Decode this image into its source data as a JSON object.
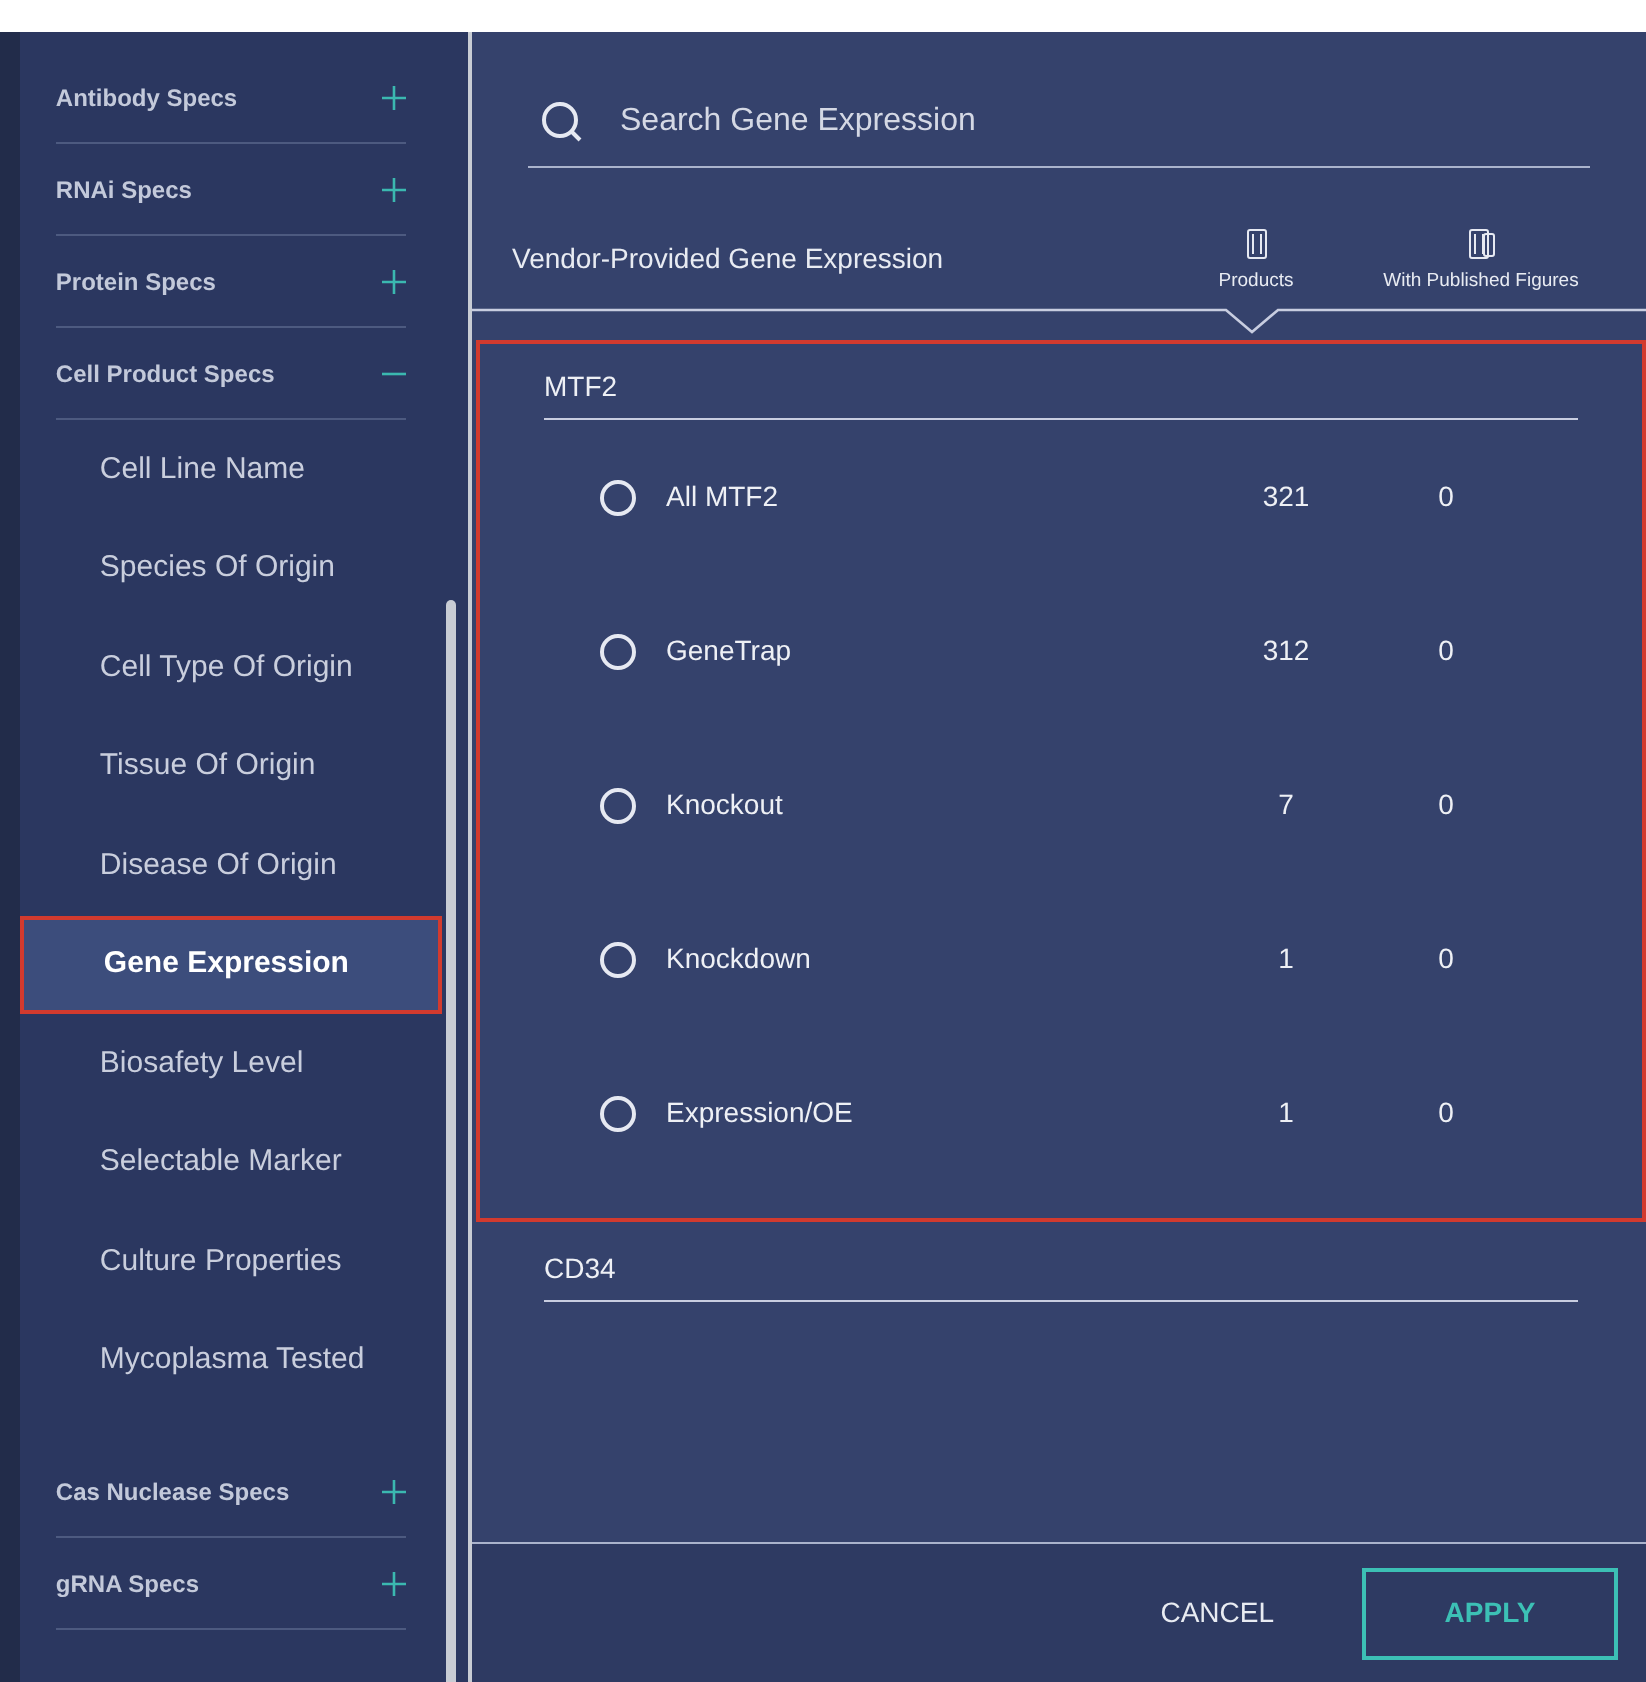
{
  "sidebar": {
    "sections": [
      {
        "label": "Antibody Specs",
        "expanded": false
      },
      {
        "label": "RNAi Specs",
        "expanded": false
      },
      {
        "label": "Protein Specs",
        "expanded": false
      },
      {
        "label": "Cell Product Specs",
        "expanded": true,
        "items": [
          {
            "label": "Cell Line Name",
            "selected": false
          },
          {
            "label": "Species Of Origin",
            "selected": false
          },
          {
            "label": "Cell Type Of Origin",
            "selected": false
          },
          {
            "label": "Tissue Of Origin",
            "selected": false
          },
          {
            "label": "Disease Of Origin",
            "selected": false
          },
          {
            "label": "Gene Expression",
            "selected": true
          },
          {
            "label": "Biosafety Level",
            "selected": false
          },
          {
            "label": "Selectable Marker",
            "selected": false
          },
          {
            "label": "Culture Properties",
            "selected": false
          },
          {
            "label": "Mycoplasma Tested",
            "selected": false
          }
        ]
      },
      {
        "label": "Cas Nuclease Specs",
        "expanded": false
      },
      {
        "label": "gRNA Specs",
        "expanded": false
      }
    ]
  },
  "search": {
    "placeholder": "Search Gene Expression"
  },
  "header": {
    "title": "Vendor-Provided Gene Expression",
    "columns": [
      "Products",
      "With Published Figures"
    ]
  },
  "groups": [
    {
      "name": "MTF2",
      "highlighted": true,
      "options": [
        {
          "label": "All MTF2",
          "selected": false,
          "products": "321",
          "figures": "0"
        },
        {
          "label": "GeneTrap",
          "selected": false,
          "products": "312",
          "figures": "0"
        },
        {
          "label": "Knockout",
          "selected": false,
          "products": "7",
          "figures": "0"
        },
        {
          "label": "Knockdown",
          "selected": false,
          "products": "1",
          "figures": "0"
        },
        {
          "label": "Expression/OE",
          "selected": false,
          "products": "1",
          "figures": "0"
        }
      ]
    },
    {
      "name": "CD34",
      "highlighted": false
    }
  ],
  "footer": {
    "cancel": "CANCEL",
    "apply": "APPLY"
  }
}
